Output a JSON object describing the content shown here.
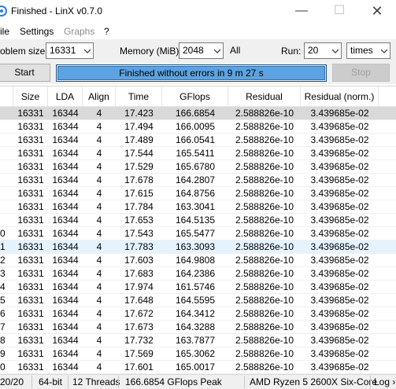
{
  "window": {
    "title": "Finished - LinX v0.7.0",
    "minimize_glyph": "—",
    "maximize_glyph": "☐",
    "close_glyph": "✕"
  },
  "menu": {
    "file": "ile",
    "settings": "Settings",
    "graphs": "Graphs",
    "help": "?"
  },
  "options": {
    "problem_size_label": "oblem size:",
    "problem_size_value": "16331",
    "memory_label": "Memory (MiB):",
    "memory_value": "2048",
    "all_label": "All",
    "run_label": "Run:",
    "run_value": "20",
    "times_value": "times"
  },
  "actions": {
    "start_label": "Start",
    "progress_text": "Finished without errors in 9 m 27 s",
    "progress_fraction": 1.0,
    "stop_label": "Stop"
  },
  "table": {
    "columns": [
      "Size",
      "LDA",
      "Align",
      "Time",
      "GFlops",
      "Residual",
      "Residual (norm.)"
    ],
    "rows": [
      {
        "num": "",
        "size": "16331",
        "lda": "16344",
        "align": "4",
        "time": "17.423",
        "gflops": "166.6854",
        "residual": "2.588826e-10",
        "norm": "3.439685e-02"
      },
      {
        "num": "",
        "size": "16331",
        "lda": "16344",
        "align": "4",
        "time": "17.494",
        "gflops": "166.0095",
        "residual": "2.588826e-10",
        "norm": "3.439685e-02"
      },
      {
        "num": "",
        "size": "16331",
        "lda": "16344",
        "align": "4",
        "time": "17.489",
        "gflops": "166.0541",
        "residual": "2.588826e-10",
        "norm": "3.439685e-02"
      },
      {
        "num": "",
        "size": "16331",
        "lda": "16344",
        "align": "4",
        "time": "17.544",
        "gflops": "165.5411",
        "residual": "2.588826e-10",
        "norm": "3.439685e-02"
      },
      {
        "num": "",
        "size": "16331",
        "lda": "16344",
        "align": "4",
        "time": "17.529",
        "gflops": "165.6780",
        "residual": "2.588826e-10",
        "norm": "3.439685e-02"
      },
      {
        "num": "",
        "size": "16331",
        "lda": "16344",
        "align": "4",
        "time": "17.678",
        "gflops": "164.2807",
        "residual": "2.588826e-10",
        "norm": "3.439685e-02"
      },
      {
        "num": "",
        "size": "16331",
        "lda": "16344",
        "align": "4",
        "time": "17.615",
        "gflops": "164.8756",
        "residual": "2.588826e-10",
        "norm": "3.439685e-02"
      },
      {
        "num": "",
        "size": "16331",
        "lda": "16344",
        "align": "4",
        "time": "17.784",
        "gflops": "163.3041",
        "residual": "2.588826e-10",
        "norm": "3.439685e-02"
      },
      {
        "num": "",
        "size": "16331",
        "lda": "16344",
        "align": "4",
        "time": "17.653",
        "gflops": "164.5135",
        "residual": "2.588826e-10",
        "norm": "3.439685e-02"
      },
      {
        "num": "0",
        "size": "16331",
        "lda": "16344",
        "align": "4",
        "time": "17.543",
        "gflops": "165.5477",
        "residual": "2.588826e-10",
        "norm": "3.439685e-02"
      },
      {
        "num": "1",
        "size": "16331",
        "lda": "16344",
        "align": "4",
        "time": "17.783",
        "gflops": "163.3093",
        "residual": "2.588826e-10",
        "norm": "3.439685e-02"
      },
      {
        "num": "2",
        "size": "16331",
        "lda": "16344",
        "align": "4",
        "time": "17.603",
        "gflops": "164.9808",
        "residual": "2.588826e-10",
        "norm": "3.439685e-02"
      },
      {
        "num": "3",
        "size": "16331",
        "lda": "16344",
        "align": "4",
        "time": "17.683",
        "gflops": "164.2386",
        "residual": "2.588826e-10",
        "norm": "3.439685e-02"
      },
      {
        "num": "4",
        "size": "16331",
        "lda": "16344",
        "align": "4",
        "time": "17.974",
        "gflops": "161.5746",
        "residual": "2.588826e-10",
        "norm": "3.439685e-02"
      },
      {
        "num": "5",
        "size": "16331",
        "lda": "16344",
        "align": "4",
        "time": "17.648",
        "gflops": "164.5595",
        "residual": "2.588826e-10",
        "norm": "3.439685e-02"
      },
      {
        "num": "6",
        "size": "16331",
        "lda": "16344",
        "align": "4",
        "time": "17.672",
        "gflops": "164.3412",
        "residual": "2.588826e-10",
        "norm": "3.439685e-02"
      },
      {
        "num": "7",
        "size": "16331",
        "lda": "16344",
        "align": "4",
        "time": "17.673",
        "gflops": "164.3288",
        "residual": "2.588826e-10",
        "norm": "3.439685e-02"
      },
      {
        "num": "8",
        "size": "16331",
        "lda": "16344",
        "align": "4",
        "time": "17.732",
        "gflops": "163.7877",
        "residual": "2.588826e-10",
        "norm": "3.439685e-02"
      },
      {
        "num": "9",
        "size": "16331",
        "lda": "16344",
        "align": "4",
        "time": "17.569",
        "gflops": "165.3062",
        "residual": "2.588826e-10",
        "norm": "3.439685e-02"
      },
      {
        "num": "0",
        "size": "16331",
        "lda": "16344",
        "align": "4",
        "time": "17.601",
        "gflops": "165.0017",
        "residual": "2.588826e-10",
        "norm": "3.439685e-02"
      }
    ]
  },
  "status": {
    "runs": "20/20",
    "bits": "64-bit",
    "threads": "12 Threads",
    "peak": "166.6854 GFlops Peak",
    "cpu": "AMD Ryzen 5 2600X Six-Core",
    "log": "Log ›"
  },
  "colors": {
    "progress_fill": "#5ea3e0",
    "selected_row": "#d9d9d9",
    "hover_row": "#e5f3ff"
  }
}
